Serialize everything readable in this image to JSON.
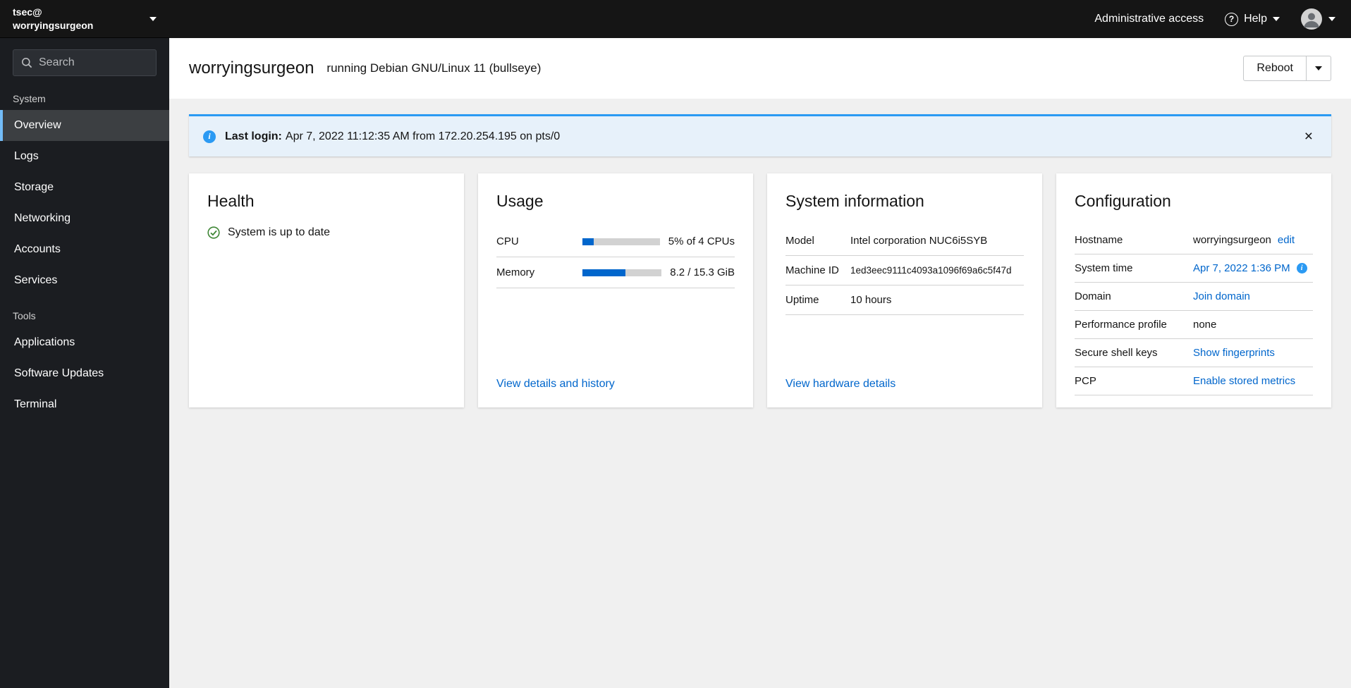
{
  "colors": {
    "accent_blue": "#0066cc",
    "alert_info_blue": "#2b9af3",
    "success_green": "#3e8635",
    "selected_nav_indicator": "#73bcf7"
  },
  "sidebar": {
    "user": "tsec@",
    "host": "worryingsurgeon",
    "search_placeholder": "Search",
    "sections": [
      {
        "label": "System",
        "items": [
          {
            "label": "Overview",
            "selected": true
          },
          {
            "label": "Logs"
          },
          {
            "label": "Storage"
          },
          {
            "label": "Networking"
          },
          {
            "label": "Accounts"
          },
          {
            "label": "Services"
          }
        ]
      },
      {
        "label": "Tools",
        "items": [
          {
            "label": "Applications"
          },
          {
            "label": "Software Updates"
          },
          {
            "label": "Terminal"
          }
        ]
      }
    ]
  },
  "masthead": {
    "admin_access": "Administrative access",
    "help": "Help"
  },
  "page_header": {
    "hostname": "worryingsurgeon",
    "os": "running Debian GNU/Linux 11 (bullseye)",
    "reboot": "Reboot"
  },
  "alert": {
    "label": "Last login:",
    "message": "Apr 7, 2022 11:12:35 AM from 172.20.254.195 on pts/0",
    "close": "×"
  },
  "health": {
    "title": "Health",
    "status": "System is up to date"
  },
  "usage": {
    "title": "Usage",
    "rows": [
      {
        "label": "CPU",
        "detail": "5% of 4 CPUs",
        "bar_percent": 15
      },
      {
        "label": "Memory",
        "detail": "8.2 / 15.3 GiB",
        "bar_percent": 54
      }
    ],
    "link": "View details and history"
  },
  "system_information": {
    "title": "System information",
    "rows": [
      {
        "label": "Model",
        "value": "Intel corporation NUC6i5SYB"
      },
      {
        "label": "Machine ID",
        "value": "1ed3eec9111c4093a1096f69a6c5f47d"
      },
      {
        "label": "Uptime",
        "value": "10 hours"
      }
    ],
    "link": "View hardware details"
  },
  "configuration": {
    "title": "Configuration",
    "hostname": {
      "label": "Hostname",
      "value": "worryingsurgeon",
      "action": "edit"
    },
    "system_time": {
      "label": "System time",
      "value": "Apr 7, 2022 1:36 PM"
    },
    "domain": {
      "label": "Domain",
      "link": "Join domain"
    },
    "performance_profile": {
      "label": "Performance profile",
      "value": "none"
    },
    "ssh_keys": {
      "label": "Secure shell keys",
      "link": "Show fingerprints"
    },
    "pcp": {
      "label": "PCP",
      "link": "Enable stored metrics"
    }
  }
}
